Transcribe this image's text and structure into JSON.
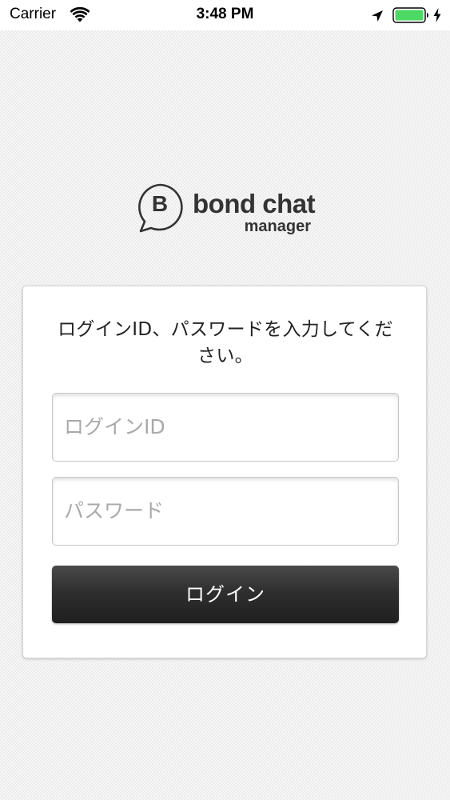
{
  "status_bar": {
    "carrier": "Carrier",
    "time": "3:48 PM",
    "icons": [
      "wifi-icon",
      "location-icon",
      "battery-icon",
      "charging-icon"
    ],
    "battery_color": "#4cd964"
  },
  "logo": {
    "badge_letter": "B",
    "name": "bond chat",
    "subtitle": "manager"
  },
  "login_form": {
    "instruction": "ログインID、パスワードを入力してください。",
    "login_id_placeholder": "ログインID",
    "password_placeholder": "パスワード",
    "login_button_label": "ログイン"
  },
  "colors": {
    "button_dark": "#2f2f2f",
    "placeholder_gray": "#a9a9a9",
    "text_dark": "#333333"
  }
}
